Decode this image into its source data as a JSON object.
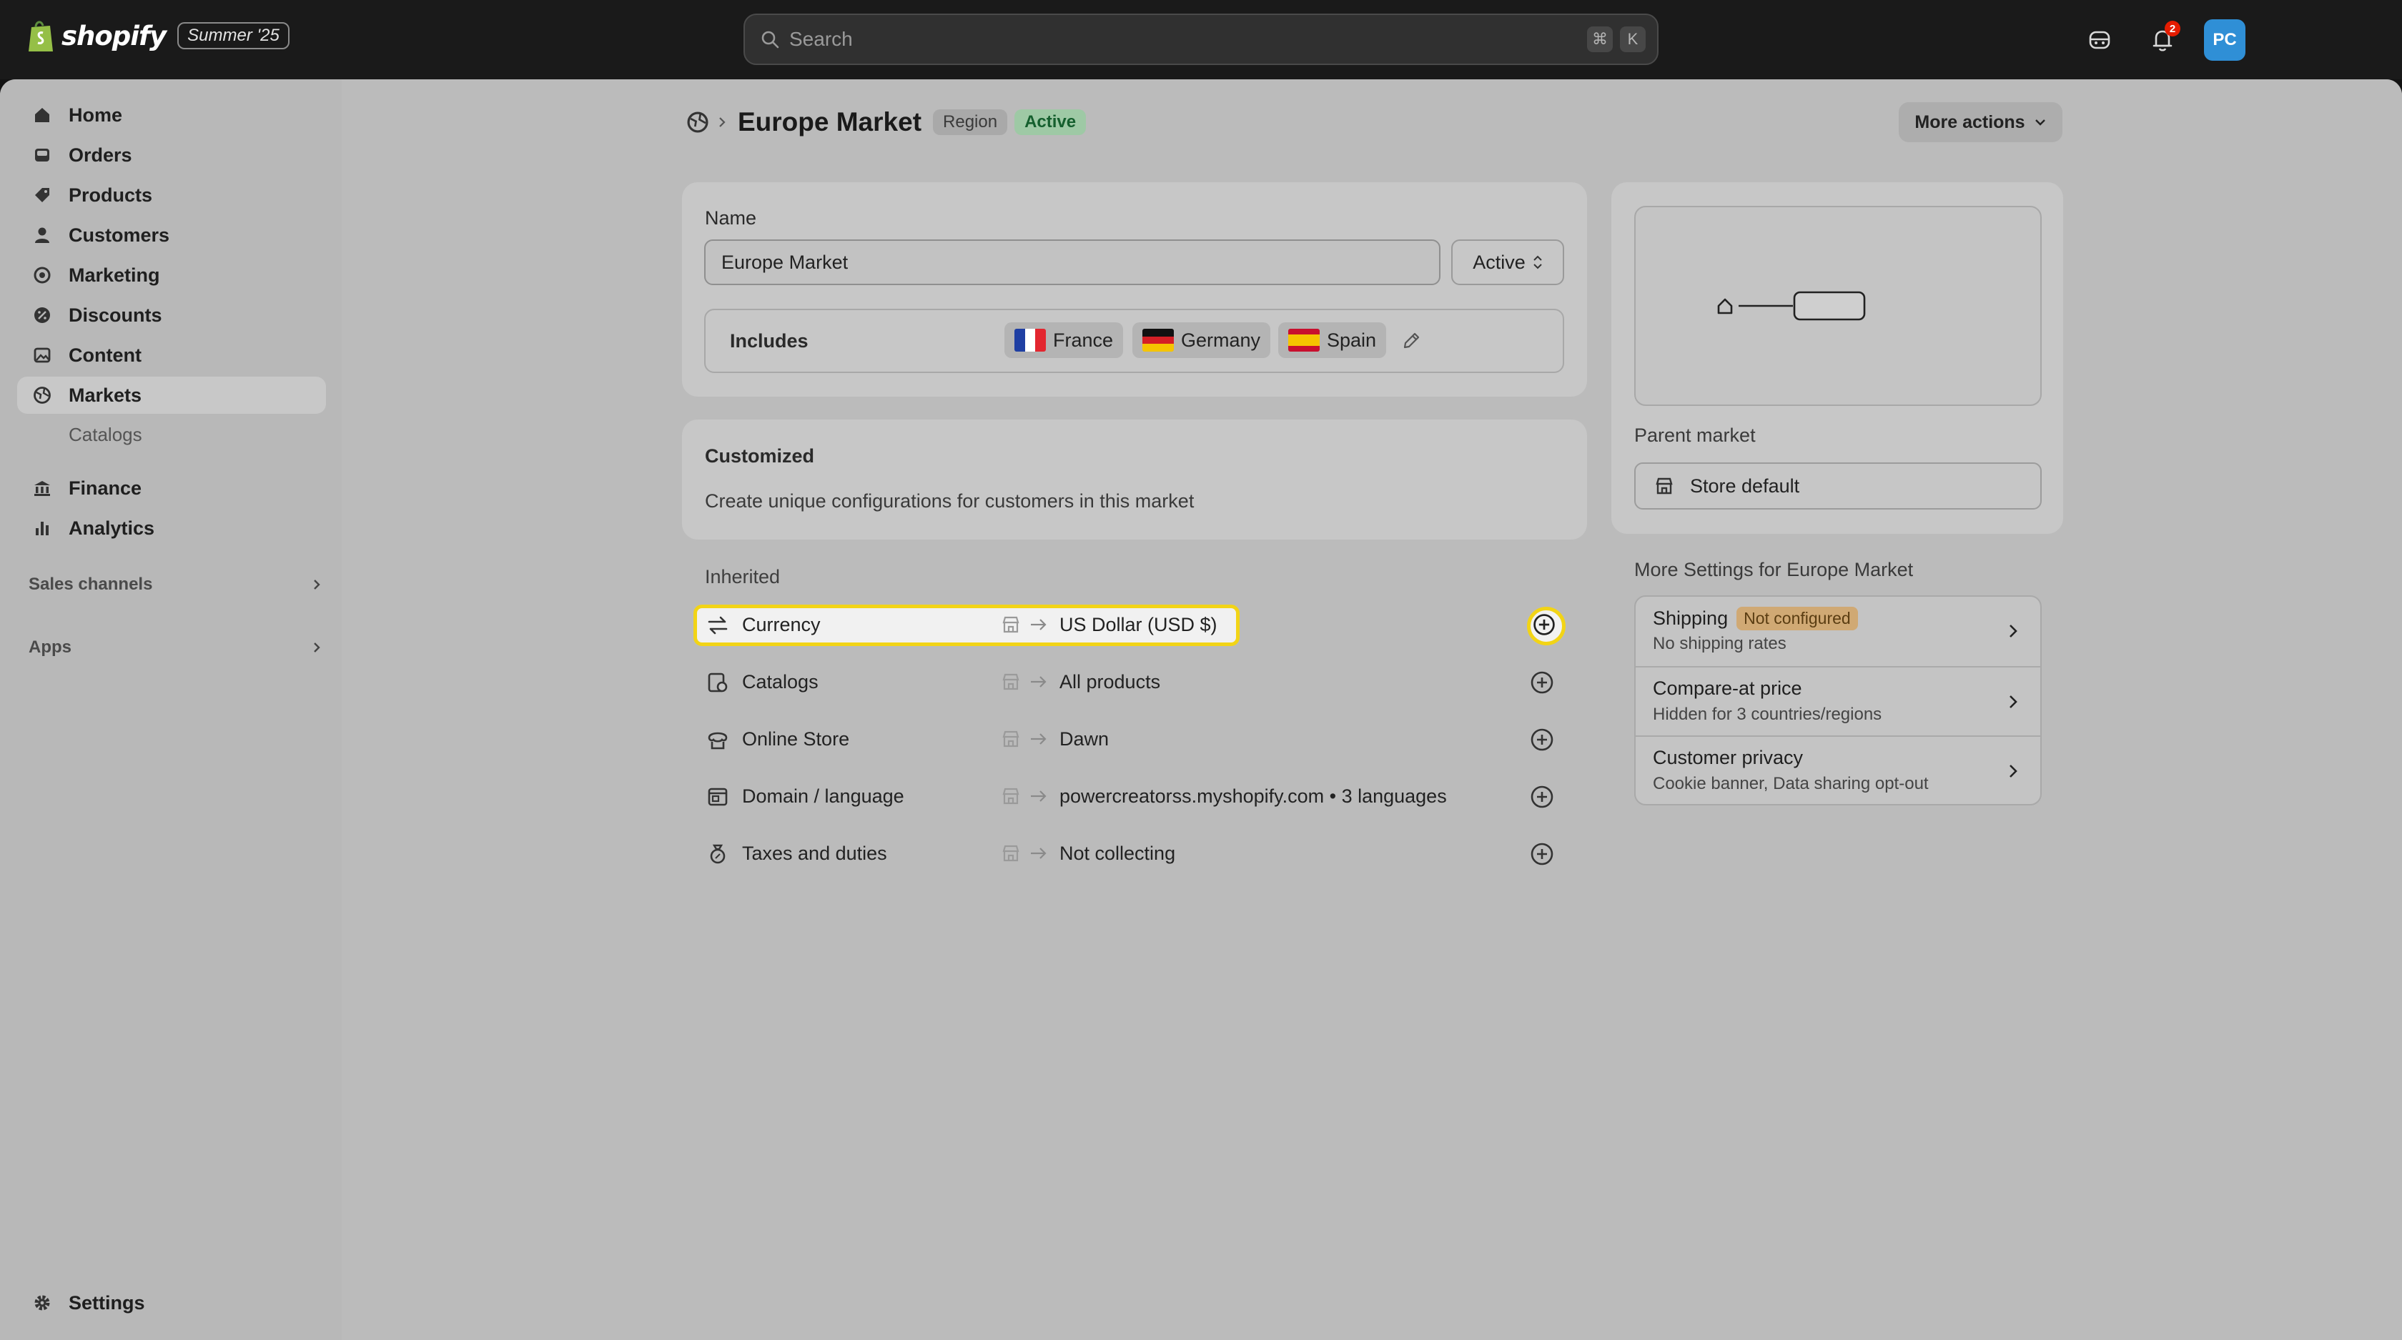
{
  "topbar": {
    "brand": "shopify",
    "edition": "Summer '25",
    "search_placeholder": "Search",
    "shortcut_keys": [
      "⌘",
      "K"
    ],
    "notification_count": "2",
    "avatar_initials": "PC"
  },
  "sidebar": {
    "items": [
      {
        "label": "Home",
        "icon": "home-icon"
      },
      {
        "label": "Orders",
        "icon": "orders-icon"
      },
      {
        "label": "Products",
        "icon": "tag-icon"
      },
      {
        "label": "Customers",
        "icon": "person-icon"
      },
      {
        "label": "Marketing",
        "icon": "target-icon"
      },
      {
        "label": "Discounts",
        "icon": "discount-icon"
      },
      {
        "label": "Content",
        "icon": "image-icon"
      },
      {
        "label": "Markets",
        "icon": "globe-icon",
        "active": true
      }
    ],
    "sub_items": [
      "Catalogs"
    ],
    "items2": [
      {
        "label": "Finance",
        "icon": "bank-icon"
      },
      {
        "label": "Analytics",
        "icon": "bar-chart-icon"
      }
    ],
    "sections": [
      "Sales channels",
      "Apps"
    ],
    "settings_label": "Settings"
  },
  "header": {
    "title": "Europe Market",
    "tag_region": "Region",
    "tag_status": "Active",
    "more_actions": "More actions"
  },
  "name_card": {
    "name_label": "Name",
    "name_value": "Europe Market",
    "status_value": "Active",
    "includes_label": "Includes",
    "countries": [
      "France",
      "Germany",
      "Spain"
    ]
  },
  "customized": {
    "title": "Customized",
    "description": "Create unique configurations for customers in this market"
  },
  "inherited": {
    "title": "Inherited",
    "rows": [
      {
        "label": "Currency",
        "value": "US Dollar (USD $)",
        "icon": "currency-exchange-icon"
      },
      {
        "label": "Catalogs",
        "value": "All products",
        "icon": "catalog-icon"
      },
      {
        "label": "Online Store",
        "value": "Dawn",
        "icon": "online-store-icon"
      },
      {
        "label": "Domain / language",
        "value": "powercreatorss.myshopify.com • 3 languages",
        "icon": "domain-icon"
      },
      {
        "label": "Taxes and duties",
        "value": "Not collecting",
        "icon": "tax-bag-icon"
      }
    ]
  },
  "parent_market": {
    "label": "Parent market",
    "value": "Store default"
  },
  "more_settings": {
    "title": "More Settings for Europe Market",
    "items": [
      {
        "title": "Shipping",
        "badge": "Not configured",
        "subtitle": "No shipping rates"
      },
      {
        "title": "Compare-at price",
        "subtitle": "Hidden for 3 countries/regions"
      },
      {
        "title": "Customer privacy",
        "subtitle": "Cookie banner, Data sharing opt-out"
      }
    ]
  },
  "colors": {
    "highlight": "#f2d416",
    "active_badge": "#9ec9a5",
    "warning_badge": "#d0a974",
    "avatar": "#2f8fd6"
  }
}
